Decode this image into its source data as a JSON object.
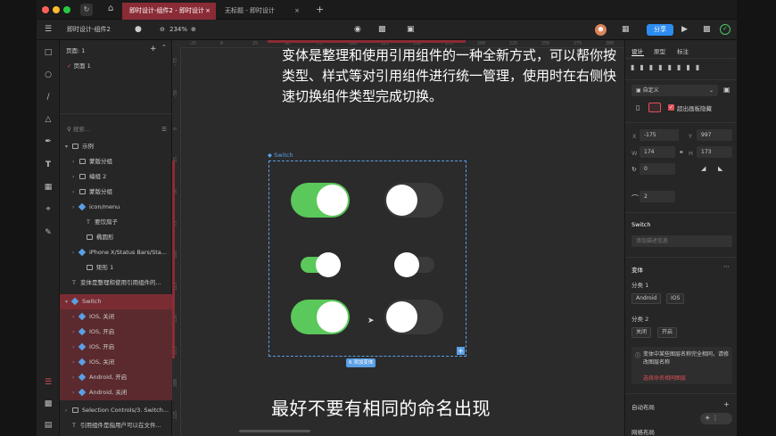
{
  "tabs": {
    "active": "即时设计-组件2 - 即时设计",
    "second": "无标题 - 即时设计",
    "add": "+"
  },
  "toolbar": {
    "file_name": "即时设计-组件2",
    "zoom": "234%",
    "share": "分享"
  },
  "layers": {
    "pages_label": "页面: 1",
    "page1": "页面 1",
    "search_placeholder": "搜索...",
    "items": [
      "示例",
      "蒙版分组",
      "编组 2",
      "蒙版分组",
      "icon/menu",
      "要饮扇子",
      "椭圆形",
      "iPhone X/Status Bars/Sta...",
      "矩形 1",
      "变体是整理和使用引用组件的...",
      "Switch",
      "IOS, 关闭",
      "IOS, 开启",
      "IOS, 开启",
      "IOS, 关闭",
      "Android, 开启",
      "Android, 关闭",
      "Selection Controls/3. Switch...",
      "引用组件是指用户可以在文件..."
    ]
  },
  "canvas": {
    "caption": "变体是整理和使用引用组件的一种全新方式，可以帮你按类型、样式等对引用组件进行统一管理，使用时在右侧快速切换组件类型完成切换。",
    "frame_label": "Switch",
    "add_variant_label": "6 添加变体",
    "ruler_top": [
      "-25",
      "0",
      "25",
      "50",
      "75",
      "100",
      "125",
      "150",
      "175",
      "200",
      "225",
      "250",
      "275",
      "300"
    ],
    "ruler_left": [
      "-75",
      "-50",
      "0",
      "25",
      "50",
      "75",
      "100",
      "125",
      "150",
      "175",
      "200",
      "225"
    ]
  },
  "subtitle": "最好不要有相同的命名出现",
  "props": {
    "tabs": [
      "设计",
      "原型",
      "标注"
    ],
    "constraint": "自定义",
    "clip_label": "超出画板隐藏",
    "x_label": "X",
    "x": "-175",
    "y_label": "Y",
    "y": "997",
    "w_label": "W",
    "w": "174",
    "h_label": "H",
    "h": "173",
    "rotation": "0",
    "radius": "2",
    "component_name": "Switch",
    "desc_placeholder": "添加描述信息",
    "variant_title": "变体",
    "group1_title": "分类 1",
    "group1_options": [
      "Android",
      "IOS"
    ],
    "group2_title": "分类 2",
    "group2_options": [
      "关闭",
      "开启"
    ],
    "warning": "变体中某些图层名称完全相同，请修改图层名称",
    "warning_link": "选择命名相同图层",
    "auto_layout": "自动布局",
    "grid_layout": "网格布局"
  },
  "colors": {
    "accent_red": "#8a2c35",
    "switch_on": "#5ac85a",
    "switch_off": "#3a3a3a",
    "share_blue": "#2d8cf0",
    "selection_blue": "#5aa0e6"
  }
}
